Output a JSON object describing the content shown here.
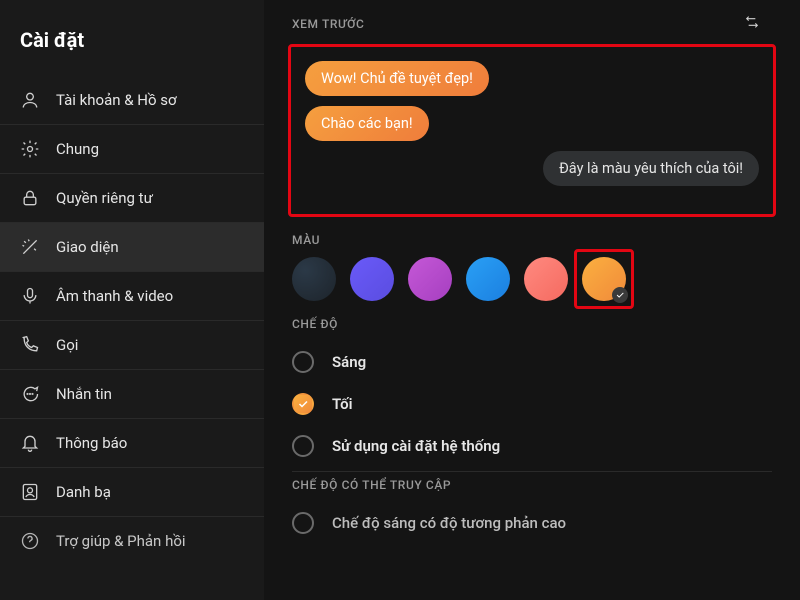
{
  "sidebar": {
    "title": "Cài đặt",
    "items": [
      {
        "label": "Tài khoản & Hồ sơ",
        "icon": "user-icon"
      },
      {
        "label": "Chung",
        "icon": "gear-icon"
      },
      {
        "label": "Quyền riêng tư",
        "icon": "lock-icon"
      },
      {
        "label": "Giao diện",
        "icon": "wand-icon"
      },
      {
        "label": "Âm thanh & video",
        "icon": "mic-icon"
      },
      {
        "label": "Gọi",
        "icon": "phone-icon"
      },
      {
        "label": "Nhắn tin",
        "icon": "chat-icon"
      },
      {
        "label": "Thông báo",
        "icon": "bell-icon"
      },
      {
        "label": "Danh bạ",
        "icon": "contacts-icon"
      },
      {
        "label": "Trợ giúp & Phản hồi",
        "icon": "help-icon"
      }
    ],
    "active_index": 3
  },
  "preview": {
    "label": "XEM TRƯỚC",
    "bubble1": "Wow! Chủ đề tuyệt đẹp!",
    "bubble2": "Chào các bạn!",
    "bubble3": "Đây là màu yêu thích của tôi!"
  },
  "color": {
    "label": "MÀU",
    "swatches": [
      {
        "name": "dark-teal",
        "hex": "#1d242b"
      },
      {
        "name": "purple",
        "hex": "#5a4de0"
      },
      {
        "name": "magenta",
        "hex": "#a63fc0"
      },
      {
        "name": "blue",
        "hex": "#1b7fe0"
      },
      {
        "name": "coral",
        "hex": "#f56a60"
      },
      {
        "name": "orange",
        "hex": "#f08a3a"
      }
    ],
    "selected_index": 5
  },
  "mode": {
    "label": "CHẾ ĐỘ",
    "options": [
      {
        "label": "Sáng"
      },
      {
        "label": "Tối"
      },
      {
        "label": "Sử dụng cài đặt hệ thống"
      }
    ],
    "selected_index": 1
  },
  "accessibility": {
    "label": "CHẾ ĐỘ CÓ THỂ TRUY CẬP",
    "option0": "Chế độ sáng có độ tương phản cao"
  },
  "annotation": {
    "highlight_color": "#e30613"
  }
}
